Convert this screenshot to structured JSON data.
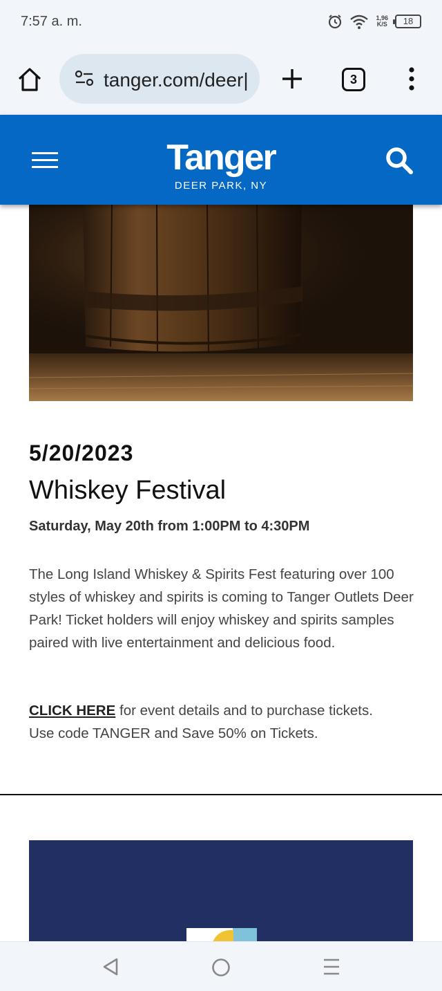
{
  "status_bar": {
    "time": "7:57 a. m.",
    "net_speed": "1,96",
    "net_unit": "K/S",
    "battery": "18"
  },
  "browser": {
    "url": "tanger.com/deer|",
    "tab_count": "3"
  },
  "header": {
    "logo": "Tanger",
    "location": "DEER PARK, NY",
    "brand_color": "#0568c4"
  },
  "event": {
    "date": "5/20/2023",
    "title": "Whiskey Festival",
    "time": "Saturday, May 20th from 1:00PM to 4:30PM",
    "description": "The Long Island Whiskey & Spirits Fest featuring over 100 styles of whiskey and spirits is coming to Tanger Outlets Deer Park!  Ticket holders will enjoy whiskey and spirits samples paired with live entertainment and delicious food.",
    "cta_link": "CLICK HERE",
    "cta_text": " for event details and to purchase tickets. Use code TANGER and Save 50% on Tickets."
  },
  "icons": {
    "home": "home-icon",
    "site_settings": "tune-icon",
    "new_tab": "plus-icon",
    "menu": "more-vert-icon",
    "site_menu": "hamburger-icon",
    "search": "search-icon",
    "nav_back": "back-triangle-icon",
    "nav_home": "home-circle-icon",
    "nav_recent": "recent-lines-icon"
  }
}
